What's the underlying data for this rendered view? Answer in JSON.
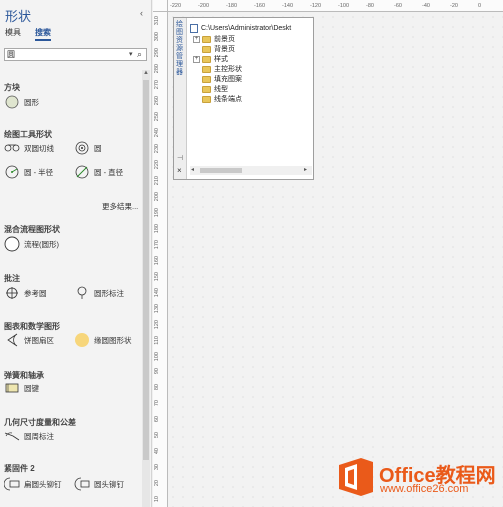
{
  "shapes_pane": {
    "title": "形状",
    "collapse_glyph": "‹",
    "tabs": {
      "stencils": "模具",
      "search": "搜索"
    },
    "search": {
      "value": "圆",
      "drop_glyph": "▾",
      "icon_glyph": "⌕"
    },
    "more_results": "更多结果...",
    "scroll_up_glyph": "▲",
    "groups": [
      {
        "title": "方块",
        "items": [
          {
            "label": "圆形",
            "icon": "circle-filled-icon"
          }
        ]
      },
      {
        "title": "绘图工具形状",
        "items": [
          {
            "label": "双圆切线",
            "icon": "double-circle-tangent-icon"
          },
          {
            "label": "圆",
            "icon": "concentric-circle-icon"
          },
          {
            "label": "圆 - 半径",
            "icon": "circle-radius-icon"
          },
          {
            "label": "圆 - 直径",
            "icon": "circle-diameter-icon"
          }
        ]
      },
      {
        "title": "混合流程图形状",
        "items": [
          {
            "label": "流程(圆形)",
            "icon": "circle-outline-icon"
          }
        ]
      },
      {
        "title": "批注",
        "items": [
          {
            "label": "参考圆",
            "icon": "reference-circle-icon"
          },
          {
            "label": "圆形标注",
            "icon": "circle-callout-icon"
          }
        ]
      },
      {
        "title": "图表和数学图形",
        "items": [
          {
            "label": "饼图扇区",
            "icon": "pie-sector-icon"
          },
          {
            "label": "缘圆图形状",
            "icon": "yellow-circle-icon"
          }
        ]
      },
      {
        "title": "弹簧和轴承",
        "items": [
          {
            "label": "圆键",
            "icon": "round-key-icon"
          }
        ]
      },
      {
        "title": "几何尺寸度量和公差",
        "items": [
          {
            "label": "圆周标注",
            "icon": "circumference-dim-icon"
          }
        ]
      },
      {
        "title": "紧固件 2",
        "items": [
          {
            "label": "扁圆头铆钉",
            "icon": "flat-rivet-icon"
          },
          {
            "label": "圆头铆钉",
            "icon": "round-rivet-icon"
          }
        ]
      }
    ]
  },
  "rulers": {
    "top": [
      "-220",
      "-200",
      "-180",
      "-160",
      "-140",
      "-120",
      "-100",
      "-80",
      "-60",
      "-40",
      "-20",
      "0"
    ],
    "left": [
      "310",
      "300",
      "290",
      "280",
      "270",
      "260",
      "250",
      "240",
      "230",
      "220",
      "210",
      "200",
      "190",
      "180",
      "170",
      "160",
      "150",
      "140",
      "130",
      "120",
      "110",
      "100",
      "90",
      "80",
      "70",
      "60",
      "50",
      "40",
      "30",
      "20",
      "10"
    ]
  },
  "explorer": {
    "title": "绘图资源管理器",
    "pin_glyph": "⊣",
    "close_glyph": "×",
    "root": "C:\\Users\\Administrator\\Deskt",
    "nodes": [
      {
        "label": "前景页",
        "expandable": true
      },
      {
        "label": "背景页",
        "expandable": false
      },
      {
        "label": "样式",
        "expandable": true
      },
      {
        "label": "主控形状",
        "expandable": false
      },
      {
        "label": "填充图案",
        "expandable": false
      },
      {
        "label": "线型",
        "expandable": false
      },
      {
        "label": "线条端点",
        "expandable": false
      }
    ],
    "expander_glyph": "+",
    "scroll_left_glyph": "◂",
    "scroll_right_glyph": "▸"
  },
  "watermark": {
    "title": "Office教程网",
    "url": "www.office26.com",
    "color": "#ea5a1a"
  }
}
